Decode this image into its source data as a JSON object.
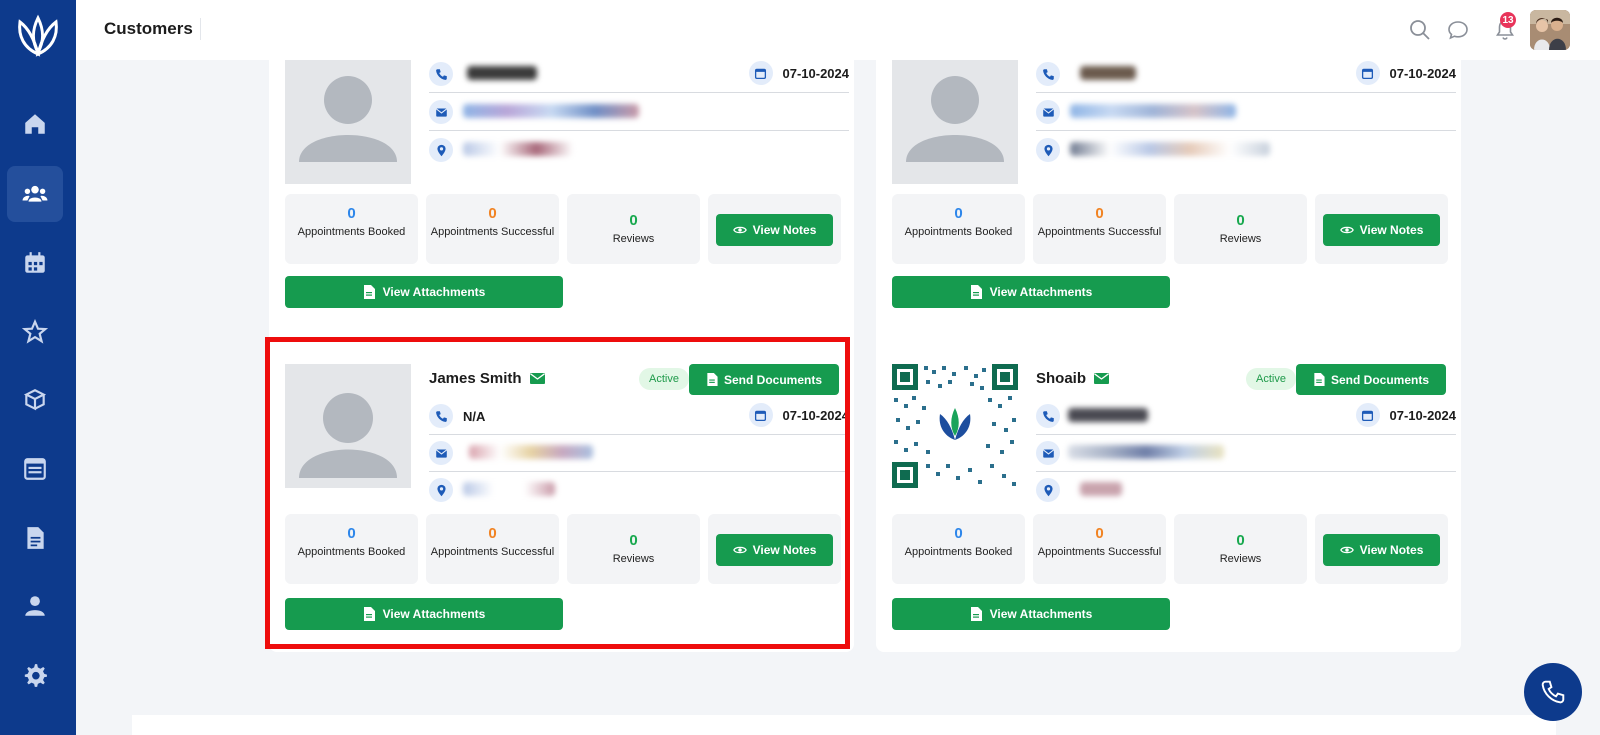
{
  "header": {
    "title": "Customers",
    "notification_count": "13"
  },
  "sidebar": {
    "items": [
      {
        "icon": "home-icon"
      },
      {
        "icon": "users-icon",
        "active": true
      },
      {
        "icon": "calendar-icon"
      },
      {
        "icon": "star-icon"
      },
      {
        "icon": "box-icon"
      },
      {
        "icon": "board-icon"
      },
      {
        "icon": "document-icon"
      },
      {
        "icon": "user-icon"
      },
      {
        "icon": "gear-icon"
      }
    ]
  },
  "labels": {
    "appointments_booked": "Appointments Booked",
    "appointments_successful": "Appointments Successful",
    "reviews": "Reviews",
    "view_notes": "View Notes",
    "view_attachments": "View Attachments",
    "send_documents": "Send Documents",
    "active": "Active"
  },
  "customers": [
    {
      "name": "",
      "phone": "",
      "date": "07-10-2024",
      "booked": "0",
      "successful": "0",
      "reviews": "0"
    },
    {
      "name": "",
      "phone": "",
      "date": "07-10-2024",
      "booked": "0",
      "successful": "0",
      "reviews": "0"
    },
    {
      "name": "James Smith",
      "phone": "N/A",
      "date": "07-10-2024",
      "status": "Active",
      "booked": "0",
      "successful": "0",
      "reviews": "0"
    },
    {
      "name": "Shoaib",
      "phone": "",
      "date": "07-10-2024",
      "status": "Active",
      "booked": "0",
      "successful": "0",
      "reviews": "0"
    }
  ],
  "colors": {
    "sidebar": "#0d3a8c",
    "primary_green": "#169b4f",
    "highlight_red": "#ee0d0d",
    "booked_blue": "#2d86ea",
    "successful_orange": "#f18322",
    "reviews_green": "#17a84e"
  }
}
